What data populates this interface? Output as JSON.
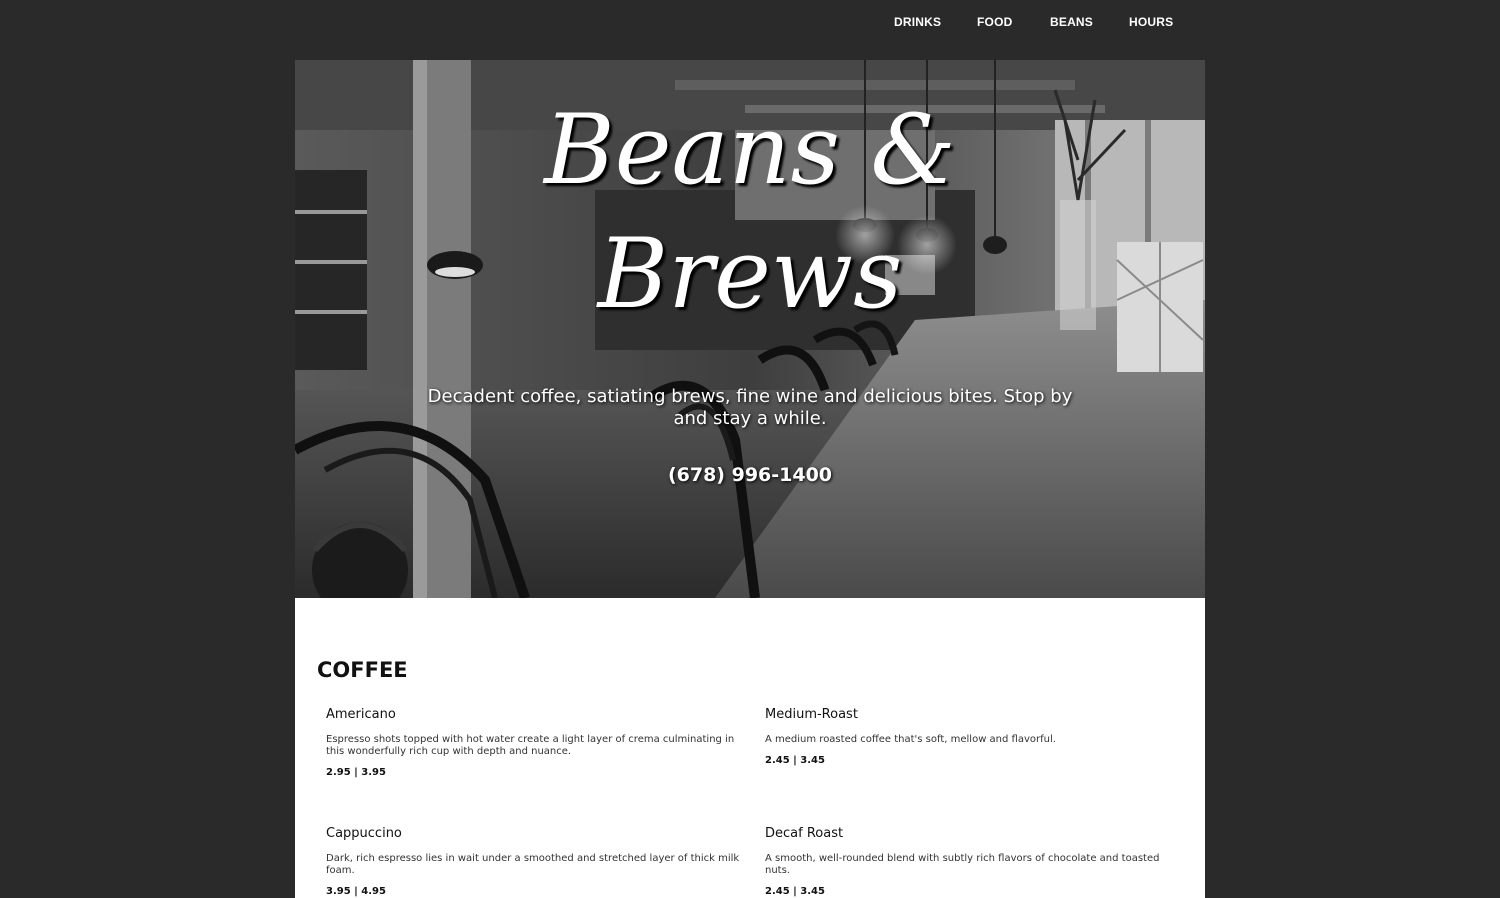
{
  "nav": {
    "items": [
      "DRINKS",
      "FOOD",
      "BEANS",
      "HOURS"
    ]
  },
  "hero": {
    "title_line1": "Beans &",
    "title_line2": "Brews",
    "tagline": "Decadent coffee, satiating brews, fine wine and delicious bites. Stop by and stay a while.",
    "phone": "(678) 996-1400"
  },
  "menu": {
    "heading": "COFFEE",
    "items": [
      {
        "name": "Americano",
        "description": "Espresso shots topped with hot water create a light layer of crema culminating in this wonderfully rich cup with depth and nuance.",
        "price": "2.95 | 3.95"
      },
      {
        "name": "Medium-Roast",
        "description": "A medium roasted coffee that's soft, mellow and flavorful.",
        "price": "2.45 | 3.45"
      },
      {
        "name": "Cappuccino",
        "description": "Dark, rich espresso lies in wait under a smoothed and stretched layer of thick milk foam.",
        "price": "3.95 | 4.95"
      },
      {
        "name": "Decaf Roast",
        "description": "A smooth, well-rounded blend with subtly rich flavors of chocolate and toasted nuts.",
        "price": "2.45 | 3.45"
      }
    ]
  },
  "colors": {
    "page_background": "#2a2a2a",
    "content_background": "#ffffff",
    "text_light": "#ffffff",
    "text_dark": "#111111"
  }
}
